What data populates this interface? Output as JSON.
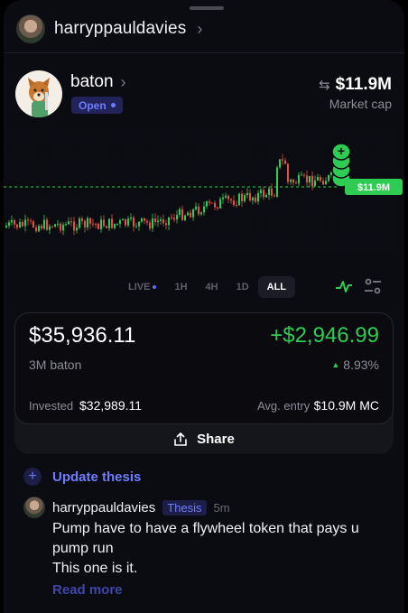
{
  "header": {
    "username": "harryppauldavies"
  },
  "token": {
    "name": "baton",
    "status": "Open",
    "market_cap": "$11.9M",
    "market_cap_label": "Market cap",
    "price_tag": "$11.9M"
  },
  "chart_data": {
    "type": "candlestick",
    "current_label": "$11.9M",
    "trend": "low flat, gradual rise, spike, settle near top"
  },
  "ranges": {
    "items": [
      "LIVE",
      "1H",
      "4H",
      "1D",
      "ALL"
    ],
    "selected": "ALL"
  },
  "position": {
    "value": "$35,936.11",
    "pnl": "+$2,946.99",
    "quantity": "3M baton",
    "pnl_pct": "8.93%",
    "invested_label": "Invested",
    "invested_value": "$32,989.11",
    "avg_entry_label": "Avg. entry",
    "avg_entry_value": "$10.9M MC",
    "share_label": "Share"
  },
  "thesis": {
    "update_label": "Update thesis"
  },
  "comment": {
    "author": "harryppauldavies",
    "tag": "Thesis",
    "time": "5m",
    "line1": "Pump have to have a flywheel token that pays u pump run",
    "line2": "This one is it.",
    "read_more": "Read more"
  },
  "colors": {
    "green": "#2ecc53",
    "accent": "#6e7dff",
    "background": "#0b0b12"
  }
}
